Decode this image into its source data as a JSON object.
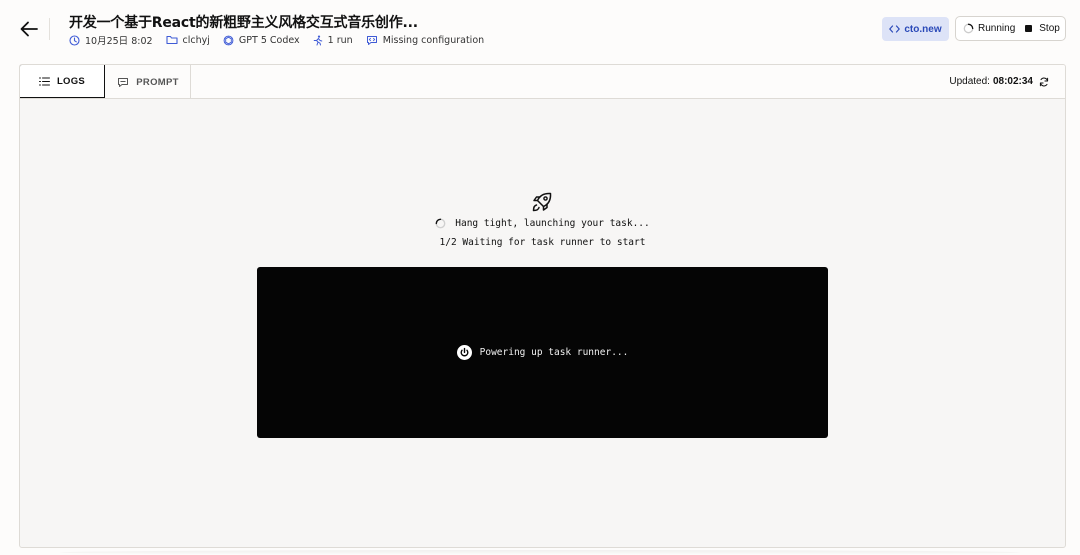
{
  "header": {
    "title": "开发一个基于React的新粗野主义风格交互式音乐创作...",
    "meta": {
      "datetime": "10月25日 8:02",
      "repo": "clchyj",
      "model": "GPT 5 Codex",
      "runs": "1 run",
      "config": "Missing configuration"
    },
    "cto_label": "cto.new",
    "status_label": "Running",
    "stop_label": "Stop"
  },
  "tabs": {
    "logs": "LOGS",
    "prompt": "PROMPT"
  },
  "updated": {
    "label": "Updated:",
    "time": "08:02:34"
  },
  "launch": {
    "message": "Hang tight, launching your task...",
    "step": "1/2 Waiting for task runner to start"
  },
  "terminal": {
    "message": "Powering up task runner..."
  },
  "icons": {
    "back": "arrow-left-icon",
    "clock": "clock-icon",
    "folder": "folder-icon",
    "model": "openai-icon",
    "run": "running-person-icon",
    "config": "chat-code-icon",
    "code": "code-icon",
    "spinner": "spinner-icon",
    "logs": "list-icon",
    "prompt": "chat-icon",
    "refresh": "refresh-icon",
    "rocket": "rocket-icon",
    "power": "power-icon"
  },
  "colors": {
    "accent": "#2a49b8",
    "accent_bg": "#dde3f7",
    "meta_icon": "#3f5bd6",
    "terminal_bg": "#050505"
  }
}
